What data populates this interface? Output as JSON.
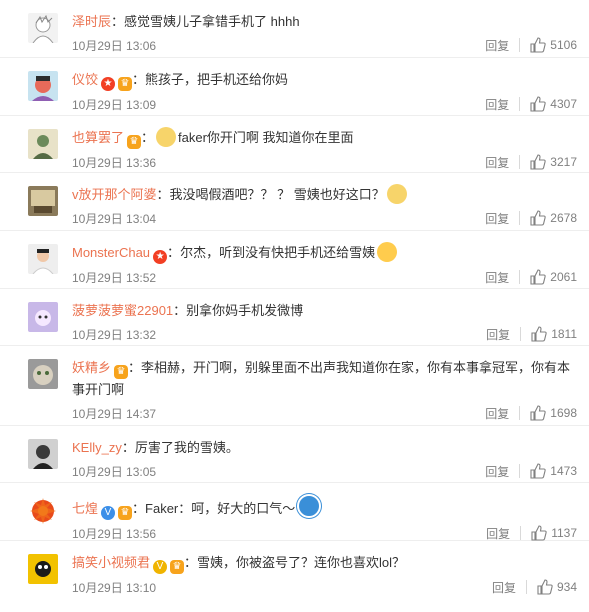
{
  "comments": [
    {
      "name": "泽时辰",
      "badges": [],
      "colon": "：",
      "text": "感觉雪姨儿子拿错手机了 hhhh",
      "emoji_after": "",
      "time": "10月29日 13:06",
      "reply": "回复",
      "likes": "5106"
    },
    {
      "name": "仪饺",
      "badges": [
        "star",
        "vip"
      ],
      "colon": "：",
      "text": "熊孩子，把手机还给你妈",
      "emoji_after": "",
      "time": "10月29日 13:09",
      "reply": "回复",
      "likes": "4307"
    },
    {
      "name": "也算罢了",
      "badges": [
        "vip"
      ],
      "colon": "：",
      "text_pre_emoji": "dog-emoji",
      "text": "faker你开门啊  我知道你在里面",
      "time": "10月29日 13:36",
      "reply": "回复",
      "likes": "3217"
    },
    {
      "name": "v放开那个阿婆",
      "badges": [],
      "colon": "：",
      "text": "我没喝假酒吧？？  ？ 雪姨也好这口？",
      "emoji_after": "dog-emoji",
      "time": "10月29日 13:04",
      "reply": "回复",
      "likes": "2678"
    },
    {
      "name": "MonsterChau",
      "badges": [
        "star"
      ],
      "colon": "：",
      "text": "尔杰，听到没有快把手机还给雪姨",
      "emoji_after": "hand-emoji",
      "time": "10月29日 13:52",
      "reply": "回复",
      "likes": "2061"
    },
    {
      "name": "菠萝菠萝蜜22901",
      "badges": [],
      "colon": "：",
      "text": "别拿你妈手机发微博",
      "emoji_after": "",
      "time": "10月29日 13:32",
      "reply": "回复",
      "likes": "1811"
    },
    {
      "name": "妖精乡",
      "badges": [
        "vip"
      ],
      "colon": "：",
      "text": "李相赫，开门啊，别躲里面不出声我知道你在家，你有本事拿冠军，你有本事开门啊",
      "emoji_after": "",
      "time": "10月29日 14:37",
      "reply": "回复",
      "likes": "1698"
    },
    {
      "name": "KElly_zy",
      "badges": [],
      "colon": "：",
      "text": "厉害了我的雪姨。",
      "emoji_after": "",
      "time": "10月29日 13:05",
      "reply": "回复",
      "likes": "1473"
    },
    {
      "name": "七煌",
      "badges": [
        "verified-blue",
        "vip"
      ],
      "colon": "：",
      "text": "Faker：呵，好大的口气～",
      "emoji_after": "robot-emoji",
      "time": "10月29日 13:56",
      "reply": "回复",
      "likes": "1137"
    },
    {
      "name": "搞笑小视频君",
      "badges": [
        "verified-gold",
        "vip-gold"
      ],
      "colon": "：",
      "text": "雪姨，你被盗号了？连你也喜欢lol？",
      "emoji_after": "",
      "time": "10月29日 13:10",
      "reply": "回复",
      "likes": "934"
    }
  ],
  "colors": {
    "name": "#eb7350",
    "meta": "#808080",
    "text": "#333333"
  }
}
